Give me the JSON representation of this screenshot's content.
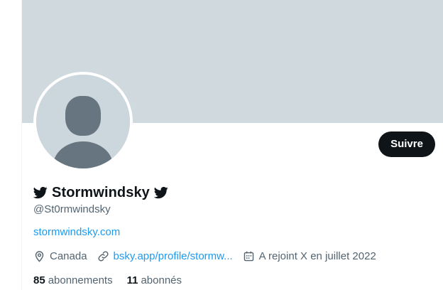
{
  "profile": {
    "display_name": "Stormwindsky",
    "handle": "@St0rmwindsky",
    "website": "stormwindsky.com",
    "location": "Canada",
    "link": "bsky.app/profile/stormw...",
    "joined": "A rejoint X en juillet 2022",
    "name_icons": [
      "bird-icon",
      "bird-icon"
    ]
  },
  "actions": {
    "follow_label": "Suivre"
  },
  "stats": {
    "following_count": "85",
    "following_label": "abonnements",
    "followers_count": "11",
    "followers_label": "abonnés"
  },
  "colors": {
    "banner": "#cfd9de",
    "accent": "#1d9bf0",
    "text": "#0f1419",
    "secondary_text": "#536471",
    "button": "#0f1419",
    "avatar_bg": "#ccd6dd",
    "avatar_figure": "#66757f"
  },
  "icons": {
    "location": "location-pin-icon",
    "link": "link-icon",
    "joined": "calendar-icon"
  }
}
